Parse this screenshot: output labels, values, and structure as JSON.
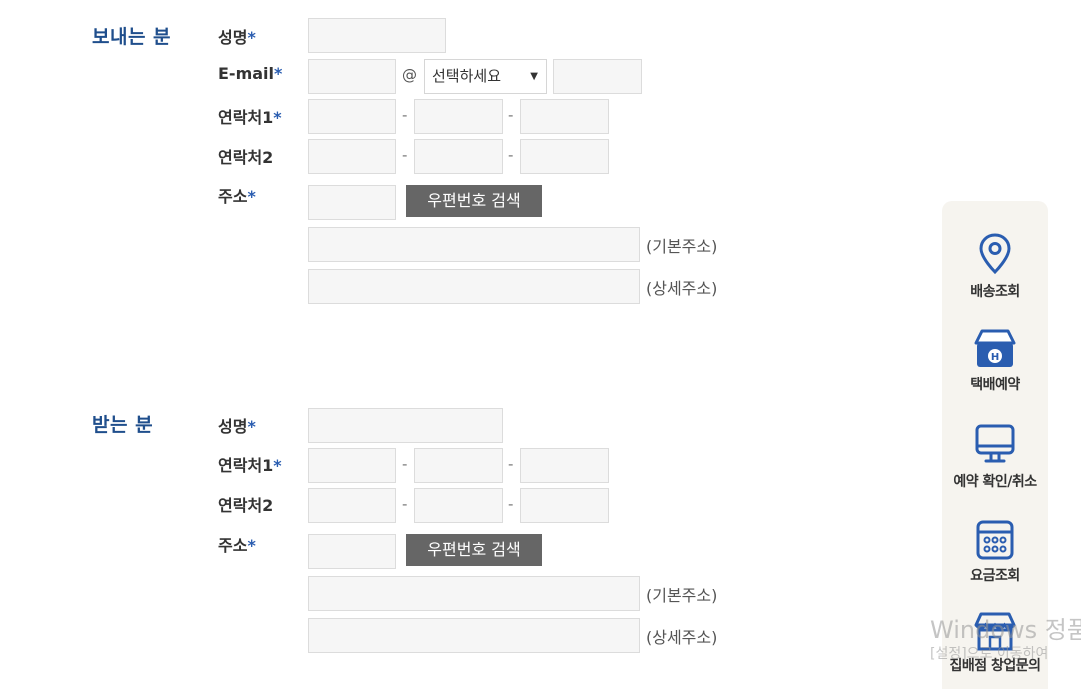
{
  "sender": {
    "title": "보내는 분",
    "name_label": "성명",
    "email_label": "E-mail",
    "email_at": "@",
    "email_domain_select": "선택하세요",
    "phone1_label": "연락처1",
    "phone2_label": "연락처2",
    "address_label": "주소",
    "zip_button": "우편번호 검색",
    "basic_address_hint": "(기본주소)",
    "detail_address_hint": "(상세주소)",
    "required_mark": "*",
    "dash": "-"
  },
  "receiver": {
    "title": "받는 분",
    "name_label": "성명",
    "phone1_label": "연락처1",
    "phone2_label": "연락처2",
    "address_label": "주소",
    "zip_button": "우편번호 검색",
    "basic_address_hint": "(기본주소)",
    "detail_address_hint": "(상세주소)",
    "required_mark": "*",
    "dash": "-"
  },
  "quick_menu": {
    "items": [
      {
        "label": "배송조회",
        "icon": "location-pin-icon"
      },
      {
        "label": "택배예약",
        "icon": "delivery-box-icon"
      },
      {
        "label": "예약 확인/취소",
        "icon": "monitor-icon"
      },
      {
        "label": "요금조회",
        "icon": "calculator-icon"
      },
      {
        "label": "집배점 창업문의",
        "icon": "storefront-icon"
      }
    ],
    "accent_color": "#2a5db0"
  },
  "watermark": {
    "line1": "Windows 정품",
    "line2": "[설정]으로 이동하여"
  }
}
